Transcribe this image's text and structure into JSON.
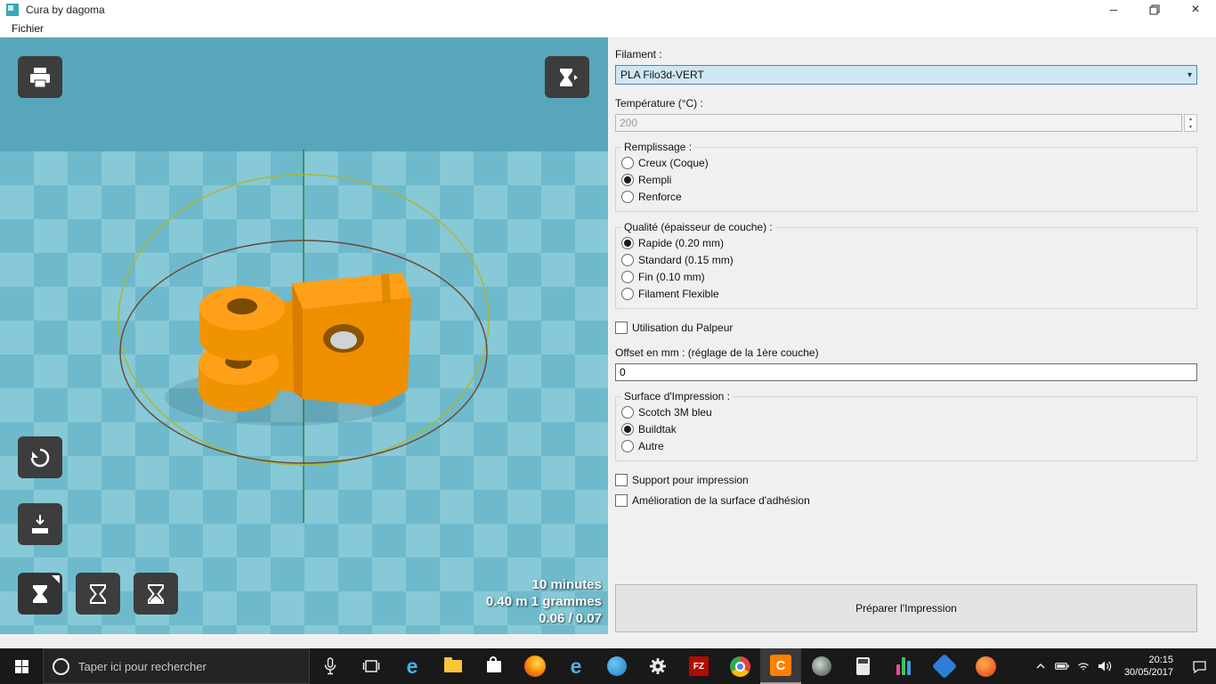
{
  "window": {
    "title": "Cura by dagoma"
  },
  "menubar": {
    "items": [
      {
        "label": "Fichier"
      }
    ]
  },
  "icons": {
    "close": "×",
    "minimize": "─",
    "chevron_down": "▾",
    "spin_up": "▲",
    "spin_down": "▼"
  },
  "viewport": {
    "stats": {
      "line1": "10 minutes",
      "line2": "0.40 m 1 grammes",
      "line3": "0.06 / 0.07"
    }
  },
  "panel": {
    "filament": {
      "label": "Filament :",
      "value": "PLA Filo3d-VERT"
    },
    "temperature": {
      "label": "Température (°C) :",
      "value": "200"
    },
    "remplissage": {
      "legend": "Remplissage :",
      "options": [
        {
          "label": "Creux (Coque)",
          "selected": false
        },
        {
          "label": "Rempli",
          "selected": true
        },
        {
          "label": "Renforce",
          "selected": false
        }
      ]
    },
    "qualite": {
      "legend": "Qualité (épaisseur de couche) :",
      "options": [
        {
          "label": "Rapide (0.20 mm)",
          "selected": true
        },
        {
          "label": "Standard (0.15 mm)",
          "selected": false
        },
        {
          "label": "Fin (0.10 mm)",
          "selected": false
        },
        {
          "label": "Filament Flexible",
          "selected": false
        }
      ]
    },
    "palpeur": {
      "label": "Utilisation du Palpeur",
      "checked": false
    },
    "offset": {
      "label": "Offset en mm : (réglage de la 1ère couche)",
      "value": "0"
    },
    "surface": {
      "legend": "Surface d'Impression :",
      "options": [
        {
          "label": "Scotch 3M bleu",
          "selected": false
        },
        {
          "label": "Buildtak",
          "selected": true
        },
        {
          "label": "Autre",
          "selected": false
        }
      ]
    },
    "support": {
      "label": "Support pour impression",
      "checked": false
    },
    "adhesion": {
      "label": "Amélioration de la surface d'adhésion",
      "checked": false
    },
    "prepare_button": "Préparer l'Impression"
  },
  "taskbar": {
    "search_placeholder": "Taper ici pour rechercher",
    "glyphs": {
      "edge": "e",
      "internet_explorer": "e",
      "filezilla": "FZ",
      "cura": "C"
    },
    "clock": {
      "time": "20:15",
      "date": "30/05/2017"
    }
  }
}
